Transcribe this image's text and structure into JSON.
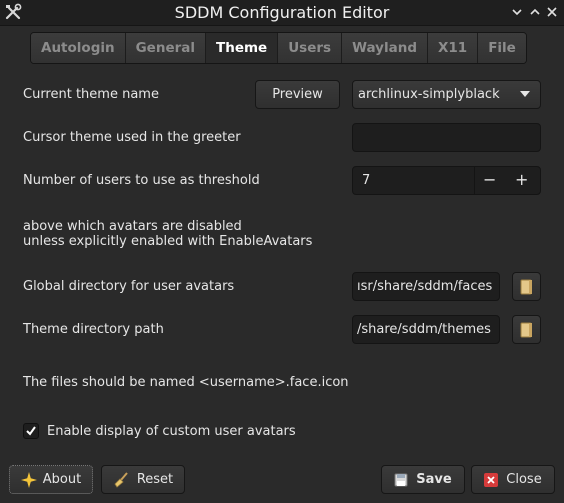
{
  "window": {
    "title": "SDDM Configuration Editor"
  },
  "tabs": [
    {
      "label": "Autologin",
      "active": false
    },
    {
      "label": "General",
      "active": false
    },
    {
      "label": "Theme",
      "active": true
    },
    {
      "label": "Users",
      "active": false
    },
    {
      "label": "Wayland",
      "active": false
    },
    {
      "label": "X11",
      "active": false
    },
    {
      "label": "File",
      "active": false
    }
  ],
  "theme": {
    "current_theme_label": "Current theme name",
    "preview_label": "Preview",
    "theme_select_value": "archlinux-simplyblack",
    "cursor_label": "Cursor theme used in the greeter",
    "cursor_value": "",
    "threshold_label": "Number of users to use as threshold",
    "threshold_value": "7",
    "threshold_minus": "−",
    "threshold_plus": "+",
    "threshold_desc_line1": "above which avatars are disabled",
    "threshold_desc_line2": "unless explicitly enabled with EnableAvatars",
    "avatars_dir_label": "Global directory for user avatars",
    "avatars_dir_value": "ısr/share/sddm/faces",
    "theme_dir_label": "Theme directory path",
    "theme_dir_value": "/share/sddm/themes",
    "files_note": "The files should be named <username>.face.icon",
    "enable_avatars_label": "Enable display of custom user avatars",
    "enable_avatars_checked": true
  },
  "footer": {
    "about_label": "About",
    "reset_label": "Reset",
    "save_label": "Save",
    "close_label": "Close"
  },
  "colors": {
    "background": "#2a2a2a",
    "titlebar": "#1f1f1f",
    "field": "#1e1e1e"
  }
}
